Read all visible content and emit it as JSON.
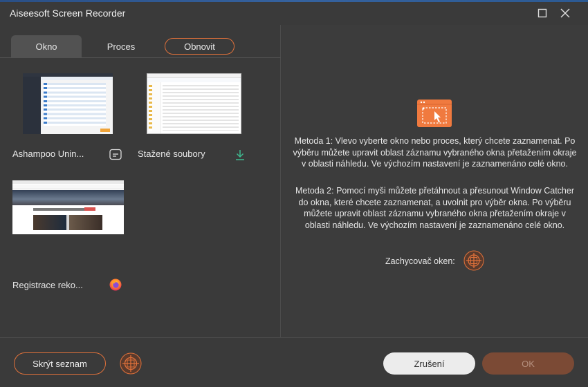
{
  "window": {
    "title": "Aiseesoft Screen Recorder"
  },
  "tabs": [
    {
      "label": "Okno",
      "active": true
    },
    {
      "label": "Proces",
      "active": false
    }
  ],
  "refresh_label": "Obnovit",
  "windows_list": [
    {
      "label": "Ashampoo Unin...",
      "icon": "app-window-icon"
    },
    {
      "label": "Stažené soubory",
      "icon": "download-arrow-icon"
    },
    {
      "label": "Registrace reko...",
      "icon": "firefox-icon"
    }
  ],
  "instructions": {
    "method1": "Metoda 1: Vlevo vyberte okno nebo proces, který chcete zaznamenat. Po výběru můžete upravit oblast záznamu vybraného okna přetažením okraje v oblasti náhledu. Ve výchozím nastavení je zaznamenáno celé okno.",
    "method2": "Metoda 2: Pomocí myši můžete přetáhnout a přesunout Window Catcher do okna, které chcete zaznamenat, a uvolnit pro výběr okna. Po výběru můžete upravit oblast záznamu vybraného okna přetažením okraje v oblasti náhledu. Ve výchozím nastavení je zaznamenáno celé okno.",
    "catcher_label": "Zachycovač oken:"
  },
  "footer": {
    "hide_list_label": "Skrýt seznam",
    "cancel_label": "Zrušení",
    "ok_label": "OK"
  },
  "colors": {
    "accent": "#e0713a",
    "background": "#3a3a3a",
    "ok_disabled": "#7b4a35",
    "download_icon": "#3fb98f"
  }
}
